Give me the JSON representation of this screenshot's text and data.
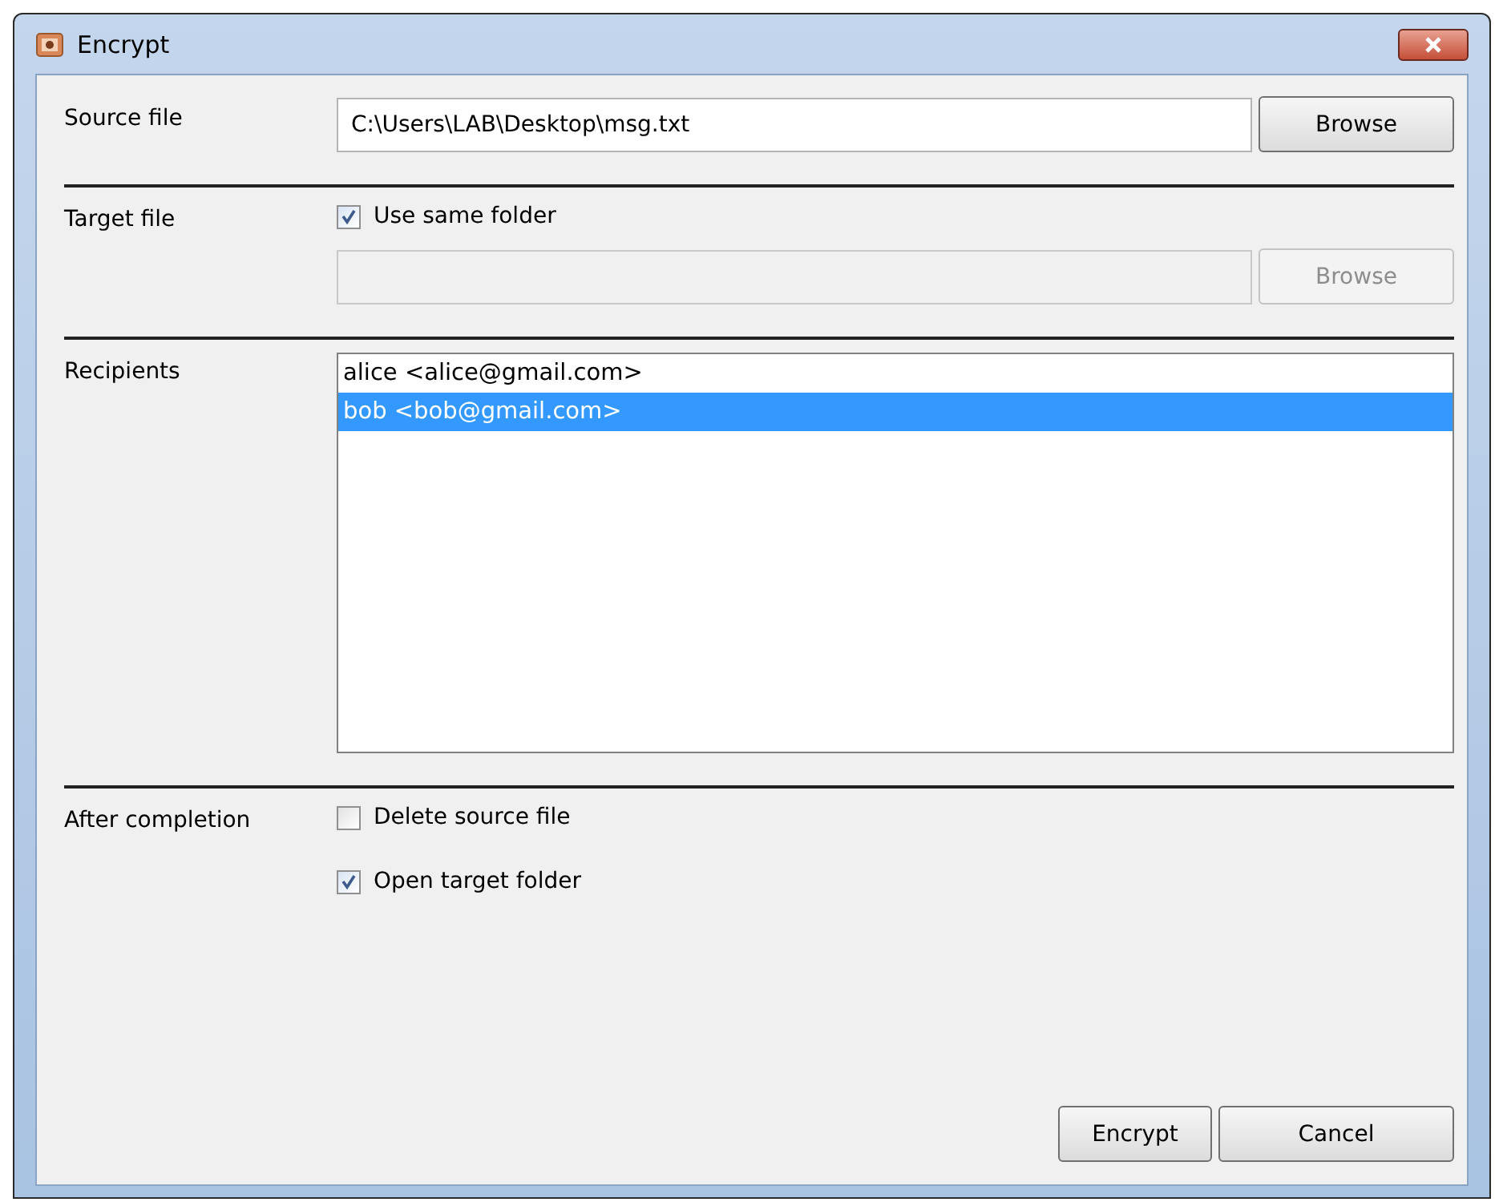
{
  "window": {
    "title": "Encrypt"
  },
  "source": {
    "label": "Source file",
    "value": "C:\\Users\\LAB\\Desktop\\msg.txt",
    "button": {
      "label": "Browse",
      "disabled": false
    }
  },
  "target": {
    "label": "Target file",
    "same_folder": {
      "label": "Use same folder",
      "checked": true
    },
    "button": {
      "label": "Browse",
      "disabled": true
    }
  },
  "recipients": {
    "label": "Recipients",
    "items": [
      {
        "text": "alice <alice@gmail.com>",
        "selected": false
      },
      {
        "text": "bob <bob@gmail.com>",
        "selected": true
      }
    ]
  },
  "after": {
    "label": "After completion",
    "options": [
      {
        "label": "Delete source file",
        "checked": false
      },
      {
        "label": "Open target folder",
        "checked": true
      }
    ]
  },
  "buttons": [
    {
      "label": "Encrypt"
    },
    {
      "label": "Cancel"
    }
  ]
}
